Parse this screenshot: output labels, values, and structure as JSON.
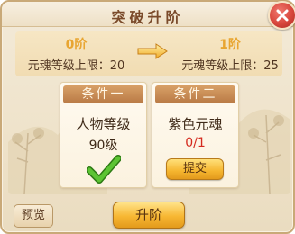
{
  "dialog": {
    "title": "突破升阶"
  },
  "upgrade": {
    "current": {
      "level_label": "0阶",
      "cap_label": "元魂等级上限",
      "cap_value": "：20"
    },
    "next": {
      "level_label": "1阶",
      "cap_label": "元魂等级上限",
      "cap_value": "：25"
    },
    "arrow_icon": "arrow-right-icon"
  },
  "conditions": [
    {
      "header": "条件一",
      "requirement": "人物等级",
      "value": "90级",
      "met": true,
      "status_icon": "checkmark-icon"
    },
    {
      "header": "条件二",
      "requirement": "紫色元魂",
      "value": "0/1",
      "met": false,
      "action_label": "提交"
    }
  ],
  "buttons": {
    "preview_label": "预览",
    "upgrade_label": "升阶",
    "close_icon": "close-icon"
  },
  "colors": {
    "level_text": "#e8a531",
    "unmet_value": "#d42a1e",
    "check_green": "#3aa81e",
    "card_header": "#b97a45",
    "close_red": "#d8463c"
  }
}
